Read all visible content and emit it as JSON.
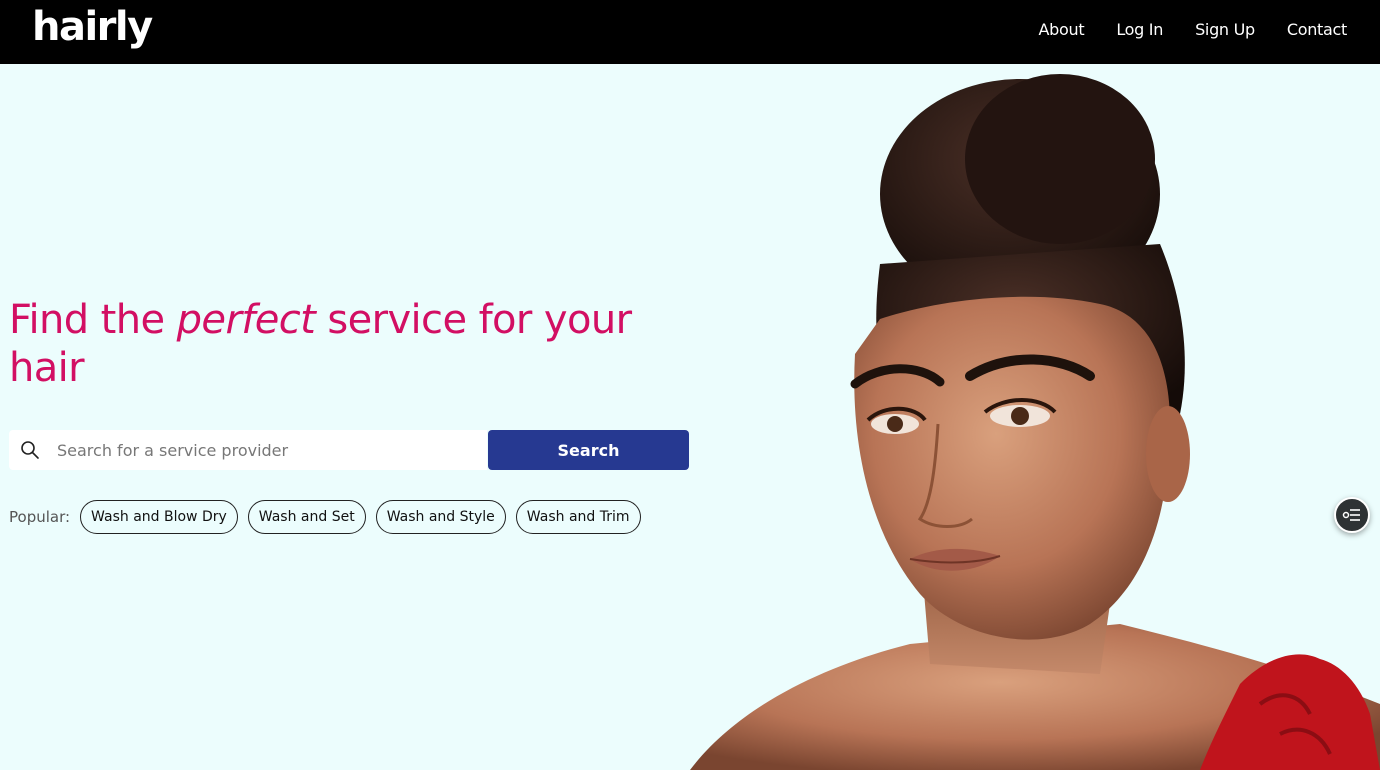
{
  "brand": {
    "logo": "hairly"
  },
  "nav": {
    "links": [
      "About",
      "Log In",
      "Sign Up",
      "Contact"
    ]
  },
  "hero": {
    "headline_before": "Find the ",
    "headline_emphasis": "perfect",
    "headline_after": " service for your hair",
    "headline_color": "#d20f63"
  },
  "search": {
    "placeholder": "Search for a service provider",
    "value": "",
    "button_label": "Search",
    "button_color": "#263991"
  },
  "popular": {
    "label": "Popular:",
    "chips": [
      "Wash and Blow Dry",
      "Wash and Set",
      "Wash and Style",
      "Wash and Trim"
    ]
  },
  "colors": {
    "nav_bg": "#000000",
    "page_bg": "#ecfdfd",
    "dress": "#c0141c"
  },
  "icons": {
    "search": "search-icon",
    "floating": "filter-list-icon"
  }
}
